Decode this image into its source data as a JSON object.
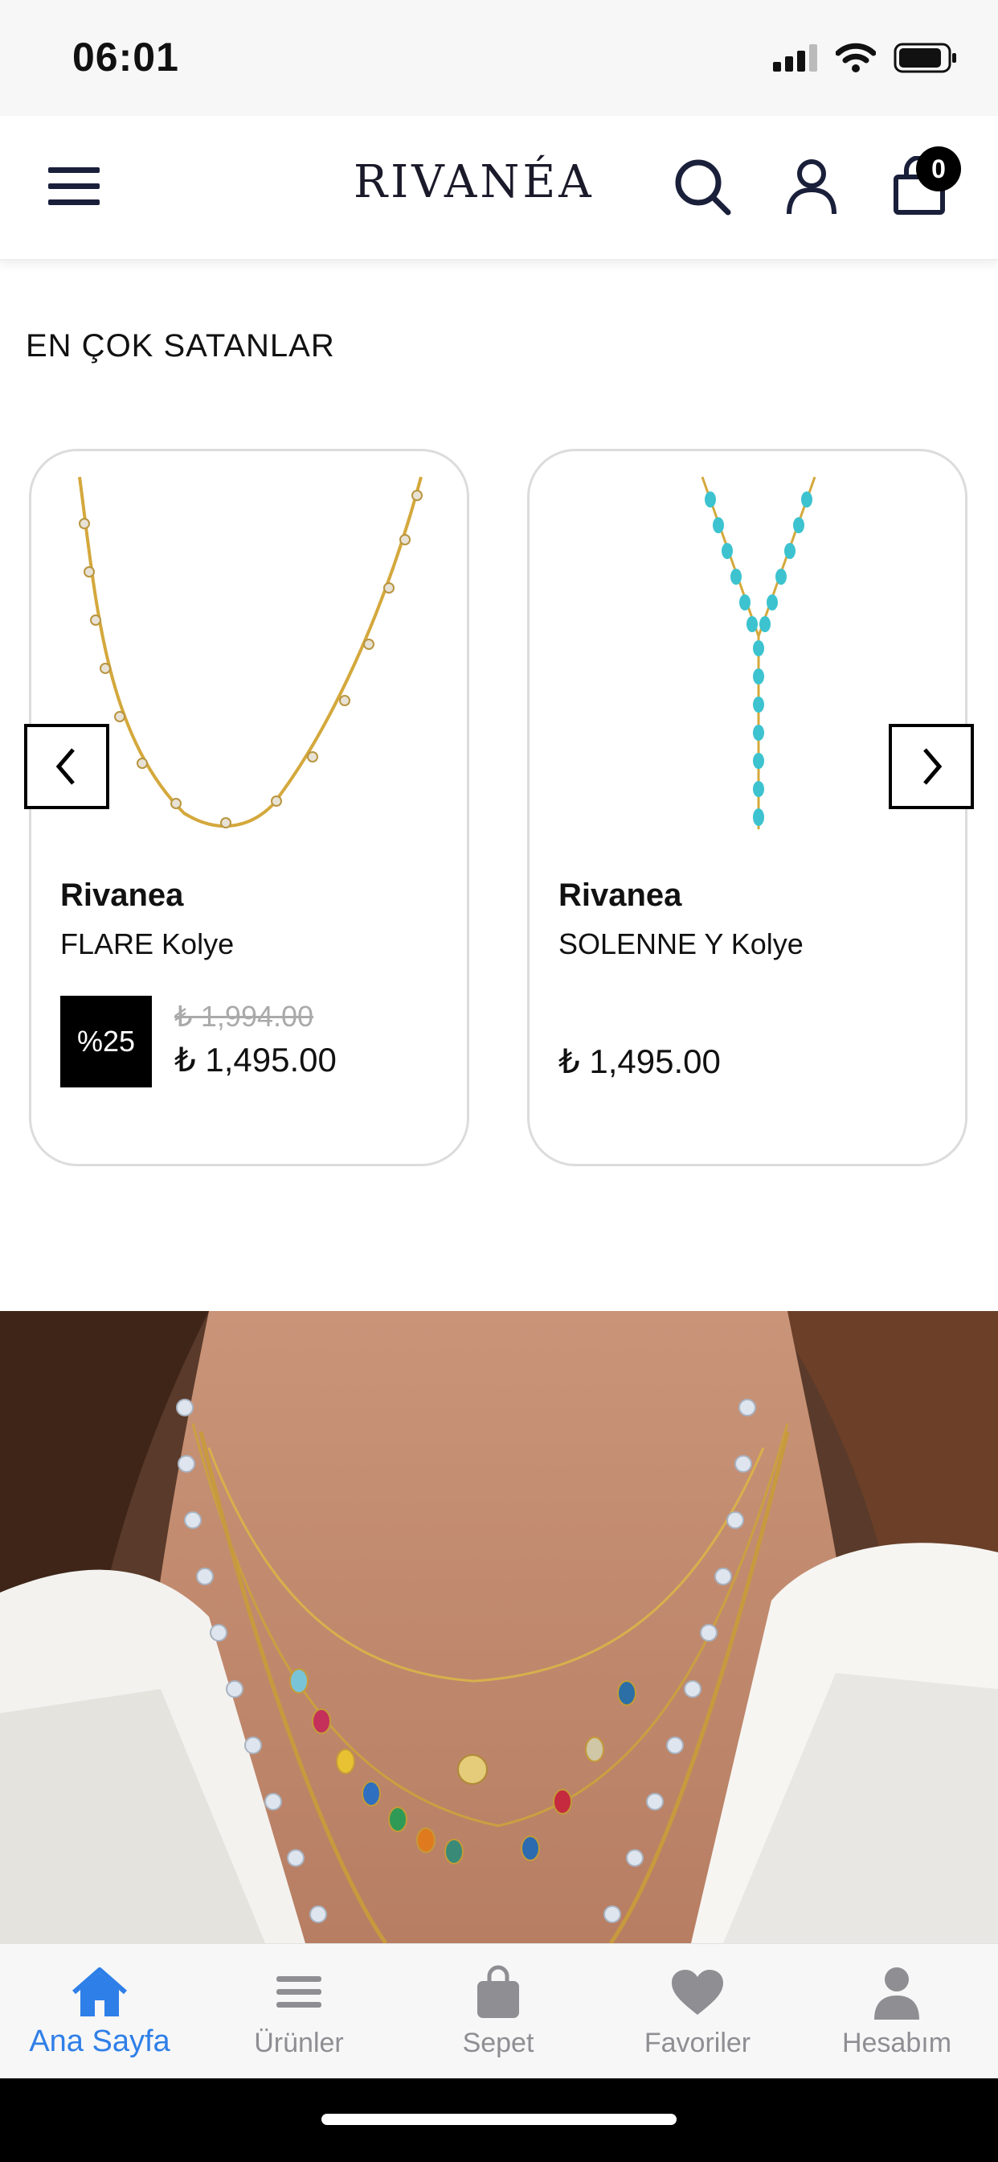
{
  "status_bar": {
    "time": "06:01"
  },
  "header": {
    "logo": "RIVANÉA",
    "cart_count": "0"
  },
  "section": {
    "title": "EN ÇOK SATANLAR"
  },
  "products": [
    {
      "brand": "Rivanea",
      "name": "FLARE Kolye",
      "discount": "%25",
      "old_price": "₺ 1,994.00",
      "price": "₺ 1,495.00"
    },
    {
      "brand": "Rivanea",
      "name": "SOLENNE Y Kolye",
      "price": "₺ 1,495.00"
    }
  ],
  "tabbar": {
    "items": [
      {
        "label": "Ana Sayfa",
        "icon": "home-icon",
        "active": true
      },
      {
        "label": "Ürünler",
        "icon": "list-icon"
      },
      {
        "label": "Sepet",
        "icon": "bag-icon"
      },
      {
        "label": "Favoriler",
        "icon": "heart-icon"
      },
      {
        "label": "Hesabım",
        "icon": "person-icon"
      }
    ]
  },
  "colors": {
    "accent": "#2f7fe8",
    "brand_dark": "#1a1f3a",
    "inactive": "#8e8e93"
  }
}
